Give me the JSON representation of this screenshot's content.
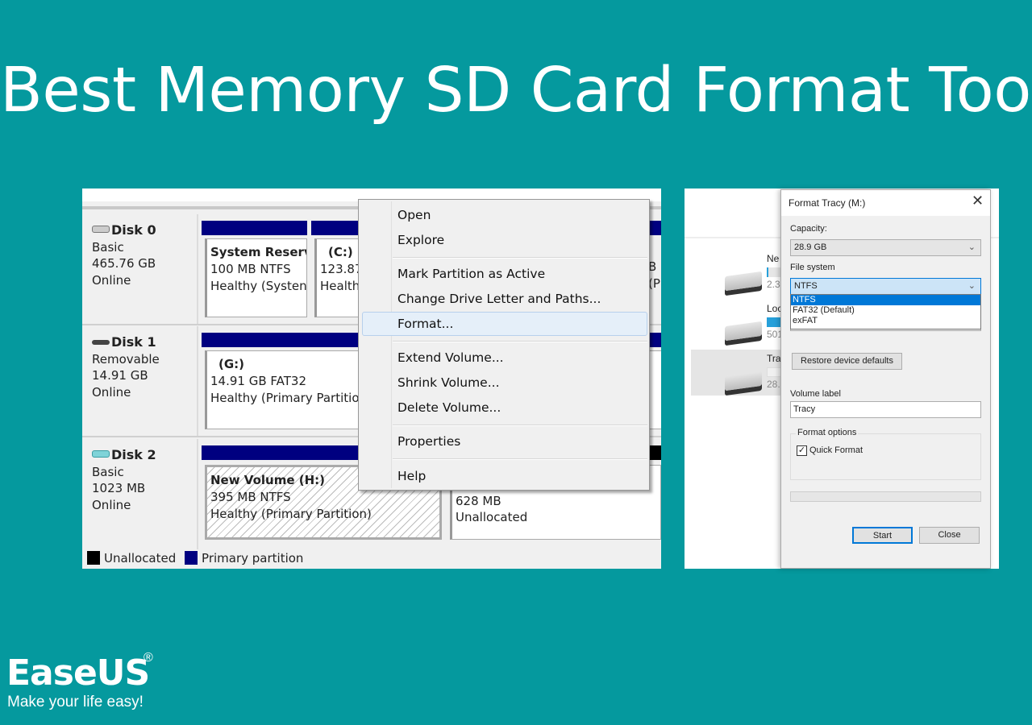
{
  "title": "Best Memory SD Card Format Tool",
  "disk_management": {
    "disks": [
      {
        "name": "Disk 0",
        "type": "Basic",
        "size": "465.76 GB",
        "status": "Online",
        "icon": "hard-disk-icon"
      },
      {
        "name": "Disk 1",
        "type": "Removable",
        "size": "14.91 GB",
        "status": "Online",
        "icon": "removable-disk-icon"
      },
      {
        "name": "Disk 2",
        "type": "Basic",
        "size": "1023 MB",
        "status": "Online",
        "icon": "usb-disk-icon"
      }
    ],
    "partitions": {
      "system_reserved": {
        "name": "System Reserv",
        "size": "100 MB NTFS",
        "status": "Healthy (Systen"
      },
      "c": {
        "name": "(C:)",
        "size": "123.87",
        "status": "Health"
      },
      "c_right": {
        "size": "B",
        "status": "(P"
      },
      "g": {
        "name": "(G:)",
        "size": "14.91 GB FAT32",
        "status": "Healthy (Primary Partitio"
      },
      "h": {
        "name": "New Volume  (H:)",
        "size": "395 MB NTFS",
        "status": "Healthy (Primary Partition)"
      },
      "unalloc": {
        "size": "628 MB",
        "status": "Unallocated"
      }
    },
    "legend": [
      {
        "label": "Unallocated",
        "color": "#000000"
      },
      {
        "label": "Primary partition",
        "color": "#000080"
      }
    ]
  },
  "context_menu": {
    "items": [
      "Open",
      "Explore",
      "Mark Partition as Active",
      "Change Drive Letter and Paths...",
      "Format...",
      "Extend Volume...",
      "Shrink Volume...",
      "Delete Volume...",
      "Properties",
      "Help"
    ],
    "highlighted": "Format..."
  },
  "explorer": {
    "drives": [
      {
        "name": "Ne",
        "size": "2.3"
      },
      {
        "name": "Loc",
        "size": "501"
      },
      {
        "name": "Tra",
        "size": "28."
      }
    ]
  },
  "format_dialog": {
    "title": "Format Tracy (M:)",
    "capacity_label": "Capacity:",
    "capacity": "28.9 GB",
    "fs_label": "File system",
    "fs_value": "NTFS",
    "fs_options": [
      "NTFS",
      "FAT32 (Default)",
      "exFAT"
    ],
    "restore": "Restore device defaults",
    "volume_label_label": "Volume label",
    "volume_label": "Tracy",
    "format_options": "Format options",
    "quick_format": "Quick Format",
    "quick_format_checked": true,
    "start": "Start",
    "close": "Close",
    "accent": "#0078d7"
  },
  "brand": {
    "logo": "EaseUS",
    "reg": "®",
    "tagline": "Make your life easy!"
  }
}
